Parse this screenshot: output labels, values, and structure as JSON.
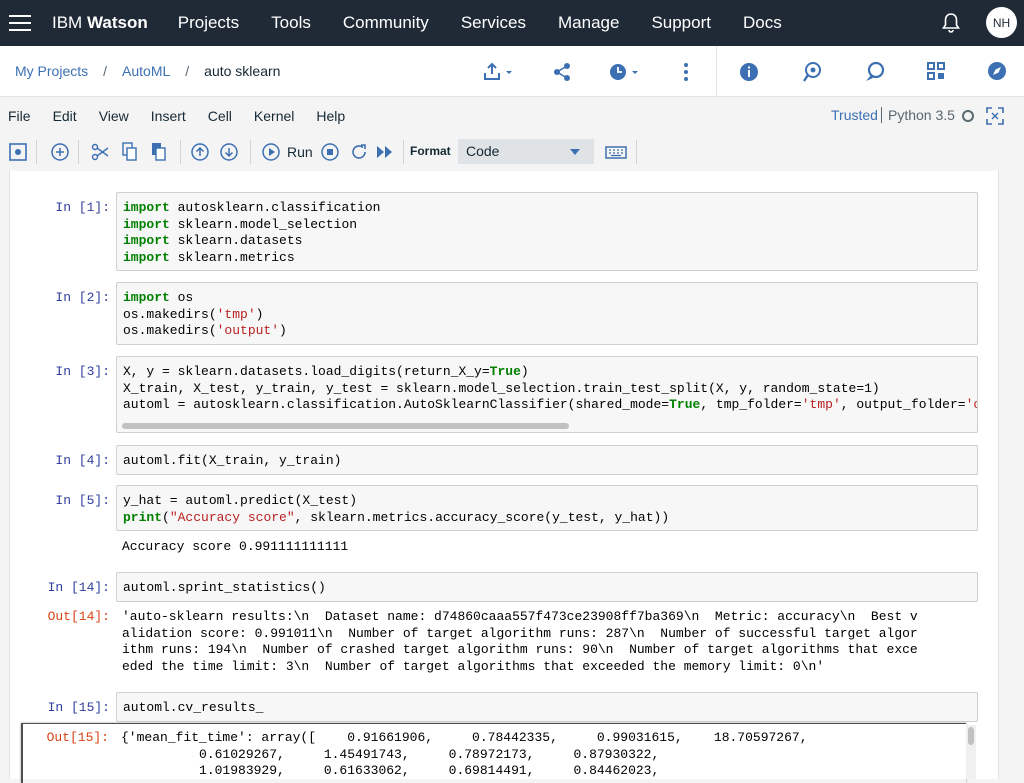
{
  "topnav": {
    "brand_prefix": "IBM",
    "brand_name": "Watson",
    "links": [
      "Projects",
      "Tools",
      "Community",
      "Services",
      "Manage",
      "Support",
      "Docs"
    ],
    "avatar_initials": "NH"
  },
  "breadcrumb": {
    "items": [
      "My Projects",
      "AutoML"
    ],
    "separator": "/",
    "current": "auto sklearn"
  },
  "menubar": {
    "items": [
      "File",
      "Edit",
      "View",
      "Insert",
      "Cell",
      "Kernel",
      "Help"
    ],
    "trusted": "Trusted",
    "kernel": "Python 3.5"
  },
  "toolbar": {
    "run_label": "Run",
    "format_label": "Format",
    "format_value": "Code"
  },
  "cells": {
    "c1": {
      "prompt": "In [1]:"
    },
    "c2": {
      "prompt": "In [2]:"
    },
    "c3": {
      "prompt": "In [3]:"
    },
    "c4": {
      "prompt": "In [4]:",
      "code": "automl.fit(X_train, y_train)"
    },
    "c5": {
      "prompt": "In [5]:",
      "output": "Accuracy score 0.991111111111"
    },
    "c14": {
      "prompt": "In [14]:",
      "code": "automl.sprint_statistics()",
      "out_prompt": "Out[14]:",
      "output": "'auto-sklearn results:\\n  Dataset name: d74860caaa557f473ce23908ff7ba369\\n  Metric: accuracy\\n  Best v\nalidation score: 0.991011\\n  Number of target algorithm runs: 287\\n  Number of successful target algor\nithm runs: 194\\n  Number of crashed target algorithm runs: 90\\n  Number of target algorithms that exce\neded the time limit: 3\\n  Number of target algorithms that exceeded the memory limit: 0\\n'"
    },
    "c15": {
      "prompt": "In [15]:",
      "code": "automl.cv_results_",
      "out_prompt": "Out[15]:",
      "output": "{'mean_fit_time': array([    0.91661906,     0.78442335,     0.99031615,    18.70597267,\n          0.61029267,     1.45491743,     0.78972173,     0.87930322,\n          1.01983929,     0.61633062,     0.69814491,     0.84462023,"
    }
  }
}
